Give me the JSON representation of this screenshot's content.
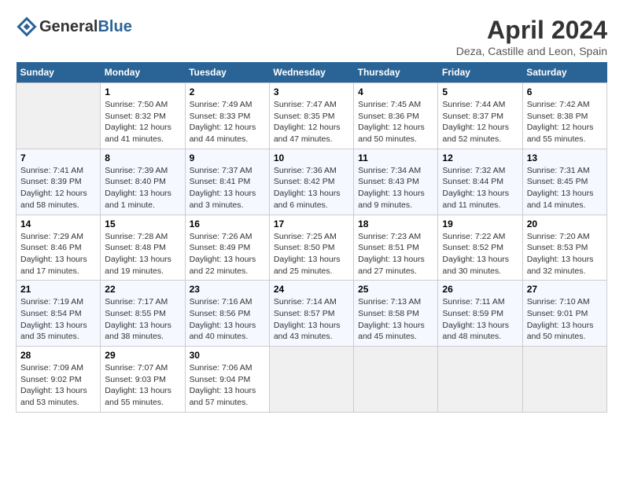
{
  "header": {
    "logo_general": "General",
    "logo_blue": "Blue",
    "month": "April 2024",
    "location": "Deza, Castille and Leon, Spain"
  },
  "columns": [
    "Sunday",
    "Monday",
    "Tuesday",
    "Wednesday",
    "Thursday",
    "Friday",
    "Saturday"
  ],
  "weeks": [
    [
      {
        "day": "",
        "sunrise": "",
        "sunset": "",
        "daylight": ""
      },
      {
        "day": "1",
        "sunrise": "Sunrise: 7:50 AM",
        "sunset": "Sunset: 8:32 PM",
        "daylight": "Daylight: 12 hours and 41 minutes."
      },
      {
        "day": "2",
        "sunrise": "Sunrise: 7:49 AM",
        "sunset": "Sunset: 8:33 PM",
        "daylight": "Daylight: 12 hours and 44 minutes."
      },
      {
        "day": "3",
        "sunrise": "Sunrise: 7:47 AM",
        "sunset": "Sunset: 8:35 PM",
        "daylight": "Daylight: 12 hours and 47 minutes."
      },
      {
        "day": "4",
        "sunrise": "Sunrise: 7:45 AM",
        "sunset": "Sunset: 8:36 PM",
        "daylight": "Daylight: 12 hours and 50 minutes."
      },
      {
        "day": "5",
        "sunrise": "Sunrise: 7:44 AM",
        "sunset": "Sunset: 8:37 PM",
        "daylight": "Daylight: 12 hours and 52 minutes."
      },
      {
        "day": "6",
        "sunrise": "Sunrise: 7:42 AM",
        "sunset": "Sunset: 8:38 PM",
        "daylight": "Daylight: 12 hours and 55 minutes."
      }
    ],
    [
      {
        "day": "7",
        "sunrise": "Sunrise: 7:41 AM",
        "sunset": "Sunset: 8:39 PM",
        "daylight": "Daylight: 12 hours and 58 minutes."
      },
      {
        "day": "8",
        "sunrise": "Sunrise: 7:39 AM",
        "sunset": "Sunset: 8:40 PM",
        "daylight": "Daylight: 13 hours and 1 minute."
      },
      {
        "day": "9",
        "sunrise": "Sunrise: 7:37 AM",
        "sunset": "Sunset: 8:41 PM",
        "daylight": "Daylight: 13 hours and 3 minutes."
      },
      {
        "day": "10",
        "sunrise": "Sunrise: 7:36 AM",
        "sunset": "Sunset: 8:42 PM",
        "daylight": "Daylight: 13 hours and 6 minutes."
      },
      {
        "day": "11",
        "sunrise": "Sunrise: 7:34 AM",
        "sunset": "Sunset: 8:43 PM",
        "daylight": "Daylight: 13 hours and 9 minutes."
      },
      {
        "day": "12",
        "sunrise": "Sunrise: 7:32 AM",
        "sunset": "Sunset: 8:44 PM",
        "daylight": "Daylight: 13 hours and 11 minutes."
      },
      {
        "day": "13",
        "sunrise": "Sunrise: 7:31 AM",
        "sunset": "Sunset: 8:45 PM",
        "daylight": "Daylight: 13 hours and 14 minutes."
      }
    ],
    [
      {
        "day": "14",
        "sunrise": "Sunrise: 7:29 AM",
        "sunset": "Sunset: 8:46 PM",
        "daylight": "Daylight: 13 hours and 17 minutes."
      },
      {
        "day": "15",
        "sunrise": "Sunrise: 7:28 AM",
        "sunset": "Sunset: 8:48 PM",
        "daylight": "Daylight: 13 hours and 19 minutes."
      },
      {
        "day": "16",
        "sunrise": "Sunrise: 7:26 AM",
        "sunset": "Sunset: 8:49 PM",
        "daylight": "Daylight: 13 hours and 22 minutes."
      },
      {
        "day": "17",
        "sunrise": "Sunrise: 7:25 AM",
        "sunset": "Sunset: 8:50 PM",
        "daylight": "Daylight: 13 hours and 25 minutes."
      },
      {
        "day": "18",
        "sunrise": "Sunrise: 7:23 AM",
        "sunset": "Sunset: 8:51 PM",
        "daylight": "Daylight: 13 hours and 27 minutes."
      },
      {
        "day": "19",
        "sunrise": "Sunrise: 7:22 AM",
        "sunset": "Sunset: 8:52 PM",
        "daylight": "Daylight: 13 hours and 30 minutes."
      },
      {
        "day": "20",
        "sunrise": "Sunrise: 7:20 AM",
        "sunset": "Sunset: 8:53 PM",
        "daylight": "Daylight: 13 hours and 32 minutes."
      }
    ],
    [
      {
        "day": "21",
        "sunrise": "Sunrise: 7:19 AM",
        "sunset": "Sunset: 8:54 PM",
        "daylight": "Daylight: 13 hours and 35 minutes."
      },
      {
        "day": "22",
        "sunrise": "Sunrise: 7:17 AM",
        "sunset": "Sunset: 8:55 PM",
        "daylight": "Daylight: 13 hours and 38 minutes."
      },
      {
        "day": "23",
        "sunrise": "Sunrise: 7:16 AM",
        "sunset": "Sunset: 8:56 PM",
        "daylight": "Daylight: 13 hours and 40 minutes."
      },
      {
        "day": "24",
        "sunrise": "Sunrise: 7:14 AM",
        "sunset": "Sunset: 8:57 PM",
        "daylight": "Daylight: 13 hours and 43 minutes."
      },
      {
        "day": "25",
        "sunrise": "Sunrise: 7:13 AM",
        "sunset": "Sunset: 8:58 PM",
        "daylight": "Daylight: 13 hours and 45 minutes."
      },
      {
        "day": "26",
        "sunrise": "Sunrise: 7:11 AM",
        "sunset": "Sunset: 8:59 PM",
        "daylight": "Daylight: 13 hours and 48 minutes."
      },
      {
        "day": "27",
        "sunrise": "Sunrise: 7:10 AM",
        "sunset": "Sunset: 9:01 PM",
        "daylight": "Daylight: 13 hours and 50 minutes."
      }
    ],
    [
      {
        "day": "28",
        "sunrise": "Sunrise: 7:09 AM",
        "sunset": "Sunset: 9:02 PM",
        "daylight": "Daylight: 13 hours and 53 minutes."
      },
      {
        "day": "29",
        "sunrise": "Sunrise: 7:07 AM",
        "sunset": "Sunset: 9:03 PM",
        "daylight": "Daylight: 13 hours and 55 minutes."
      },
      {
        "day": "30",
        "sunrise": "Sunrise: 7:06 AM",
        "sunset": "Sunset: 9:04 PM",
        "daylight": "Daylight: 13 hours and 57 minutes."
      },
      {
        "day": "",
        "sunrise": "",
        "sunset": "",
        "daylight": ""
      },
      {
        "day": "",
        "sunrise": "",
        "sunset": "",
        "daylight": ""
      },
      {
        "day": "",
        "sunrise": "",
        "sunset": "",
        "daylight": ""
      },
      {
        "day": "",
        "sunrise": "",
        "sunset": "",
        "daylight": ""
      }
    ]
  ]
}
